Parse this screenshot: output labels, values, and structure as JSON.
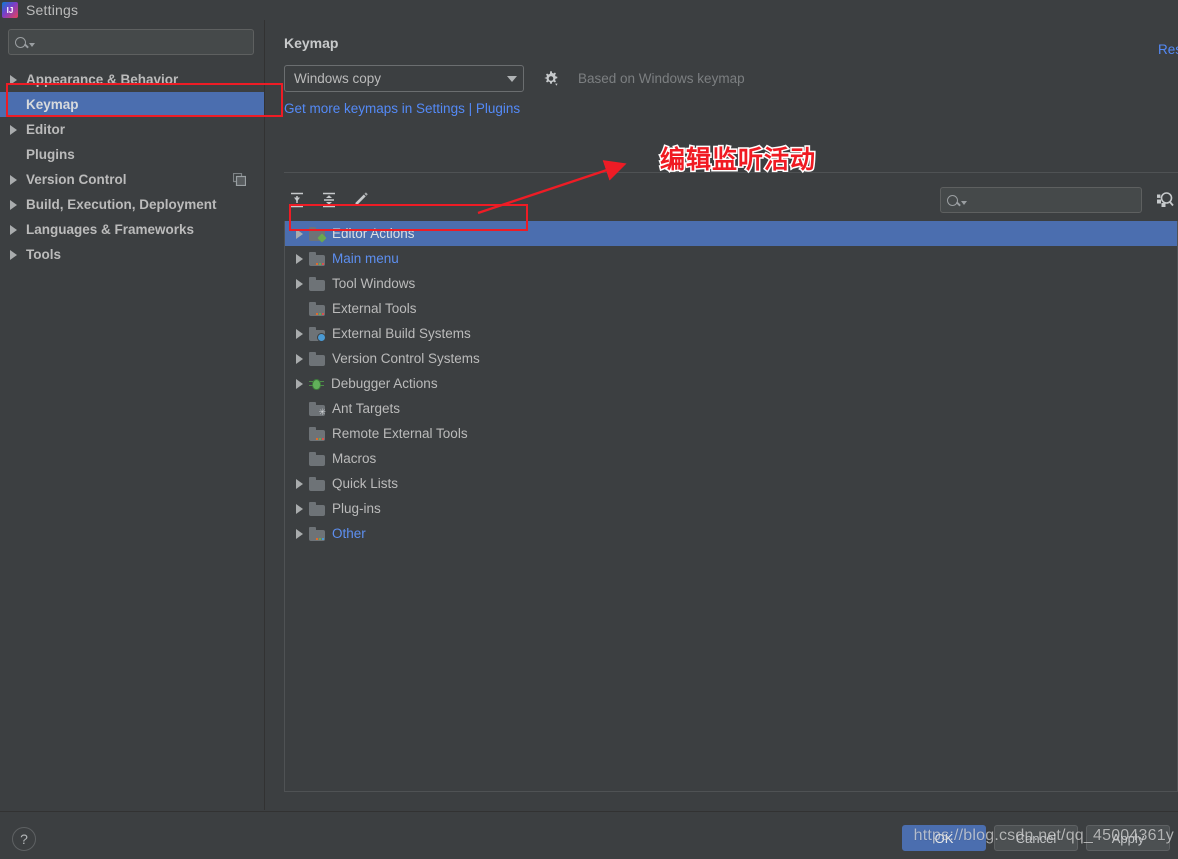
{
  "window": {
    "title": "Settings",
    "logo_icon": "intellij-idea-logo"
  },
  "colors": {
    "background": "#3c3f41",
    "selection_blue": "#4b6eaf",
    "link_blue": "#548af7",
    "annotation_red": "#ee1c25",
    "text_primary": "#bbbbbb",
    "text_muted": "#7c7f81"
  },
  "sidebar": {
    "search": {
      "placeholder": "",
      "value": "",
      "icon": "search-icon"
    },
    "items": [
      {
        "label": "Appearance & Behavior",
        "expandable": true,
        "selected": false,
        "trailing_icon": null
      },
      {
        "label": "Keymap",
        "expandable": false,
        "selected": true,
        "trailing_icon": null
      },
      {
        "label": "Editor",
        "expandable": true,
        "selected": false,
        "trailing_icon": null
      },
      {
        "label": "Plugins",
        "expandable": false,
        "selected": false,
        "trailing_icon": null
      },
      {
        "label": "Version Control",
        "expandable": true,
        "selected": false,
        "trailing_icon": "copy-icon"
      },
      {
        "label": "Build, Execution, Deployment",
        "expandable": true,
        "selected": false,
        "trailing_icon": null
      },
      {
        "label": "Languages & Frameworks",
        "expandable": true,
        "selected": false,
        "trailing_icon": null
      },
      {
        "label": "Tools",
        "expandable": true,
        "selected": false,
        "trailing_icon": null
      }
    ]
  },
  "pane": {
    "title": "Keymap",
    "keymap_select": {
      "value": "Windows copy",
      "caret_icon": "chevron-down-icon"
    },
    "gear_icon": "gear-icon",
    "based_on": "Based on Windows keymap",
    "plugins_link": "Get more keymaps in Settings | Plugins",
    "reset_link": "Reset"
  },
  "toolbar": {
    "buttons": [
      {
        "name": "expand-all-button",
        "icon": "expand-all-icon"
      },
      {
        "name": "collapse-all-button",
        "icon": "collapse-all-icon"
      },
      {
        "name": "edit-shortcut-button",
        "icon": "pencil-icon"
      }
    ],
    "search": {
      "placeholder": "",
      "value": "",
      "icon": "search-icon"
    },
    "find_by_shortcut_icon": "find-by-shortcut-icon"
  },
  "tree": {
    "items": [
      {
        "label": "Editor Actions",
        "expandable": true,
        "selected": true,
        "icon": "folder-pencil-icon",
        "link_style": false
      },
      {
        "label": "Main menu",
        "expandable": true,
        "selected": false,
        "icon": "folder-dots-icon",
        "link_style": true
      },
      {
        "label": "Tool Windows",
        "expandable": true,
        "selected": false,
        "icon": "folder-icon",
        "link_style": false
      },
      {
        "label": "External Tools",
        "expandable": false,
        "selected": false,
        "icon": "folder-dots-icon",
        "link_style": false
      },
      {
        "label": "External Build Systems",
        "expandable": true,
        "selected": false,
        "icon": "folder-cog-icon",
        "link_style": false
      },
      {
        "label": "Version Control Systems",
        "expandable": true,
        "selected": false,
        "icon": "folder-icon",
        "link_style": false
      },
      {
        "label": "Debugger Actions",
        "expandable": true,
        "selected": false,
        "icon": "bug-icon",
        "link_style": false
      },
      {
        "label": "Ant Targets",
        "expandable": false,
        "selected": false,
        "icon": "folder-ant-icon",
        "link_style": false
      },
      {
        "label": "Remote External Tools",
        "expandable": false,
        "selected": false,
        "icon": "folder-dots-icon",
        "link_style": false
      },
      {
        "label": "Macros",
        "expandable": false,
        "selected": false,
        "icon": "folder-icon",
        "link_style": false
      },
      {
        "label": "Quick Lists",
        "expandable": true,
        "selected": false,
        "icon": "folder-icon",
        "link_style": false
      },
      {
        "label": "Plug-ins",
        "expandable": true,
        "selected": false,
        "icon": "folder-icon",
        "link_style": false
      },
      {
        "label": "Other",
        "expandable": true,
        "selected": false,
        "icon": "folder-dots-icon",
        "link_style": true
      }
    ]
  },
  "footer": {
    "help_icon": "question-mark-icon",
    "ok_label": "OK",
    "cancel_label": "Cancel",
    "apply_label": "Apply"
  },
  "annotations": {
    "callout_text": "编辑监听活动",
    "arrow": "red-arrow-pointing-up-right",
    "highlight_keymap": "red-rectangle-around-keymap",
    "highlight_editor_actions": "red-rectangle-around-editor-actions"
  },
  "watermark": {
    "text": "https://blog.csdn.net/qq_45004361y"
  }
}
